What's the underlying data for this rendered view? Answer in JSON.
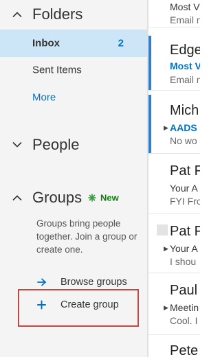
{
  "nav": {
    "folders": {
      "title": "Folders",
      "items": [
        {
          "label": "Inbox",
          "count": "2"
        },
        {
          "label": "Sent Items"
        },
        {
          "label": "More"
        }
      ]
    },
    "people": {
      "title": "People"
    },
    "groups": {
      "title": "Groups",
      "new_badge": "New",
      "description": "Groups bring people together. Join a group or create one.",
      "browse_label": "Browse groups",
      "create_label": "Create group"
    }
  },
  "message_list": [
    {
      "sender": "",
      "subject": "Most V",
      "preview": "Email n"
    },
    {
      "sender": "Edge",
      "subject": "Most V",
      "preview": "Email n"
    },
    {
      "sender": "Mich",
      "subject": "AADS",
      "preview": "No wo"
    },
    {
      "sender": "Pat F",
      "subject": "Your A",
      "preview": "FYI Fro"
    },
    {
      "sender": "Pat F",
      "subject": "Your A",
      "preview": "I shou"
    },
    {
      "sender": "Paul",
      "subject": "Meetin",
      "preview": "Cool. I"
    },
    {
      "sender": "Pete",
      "subject": "",
      "preview": ""
    }
  ],
  "colors": {
    "accent_blue": "#0072c6",
    "selected_bg": "#cde6f7",
    "new_green": "#107c10",
    "highlight_red": "#c8463d"
  }
}
